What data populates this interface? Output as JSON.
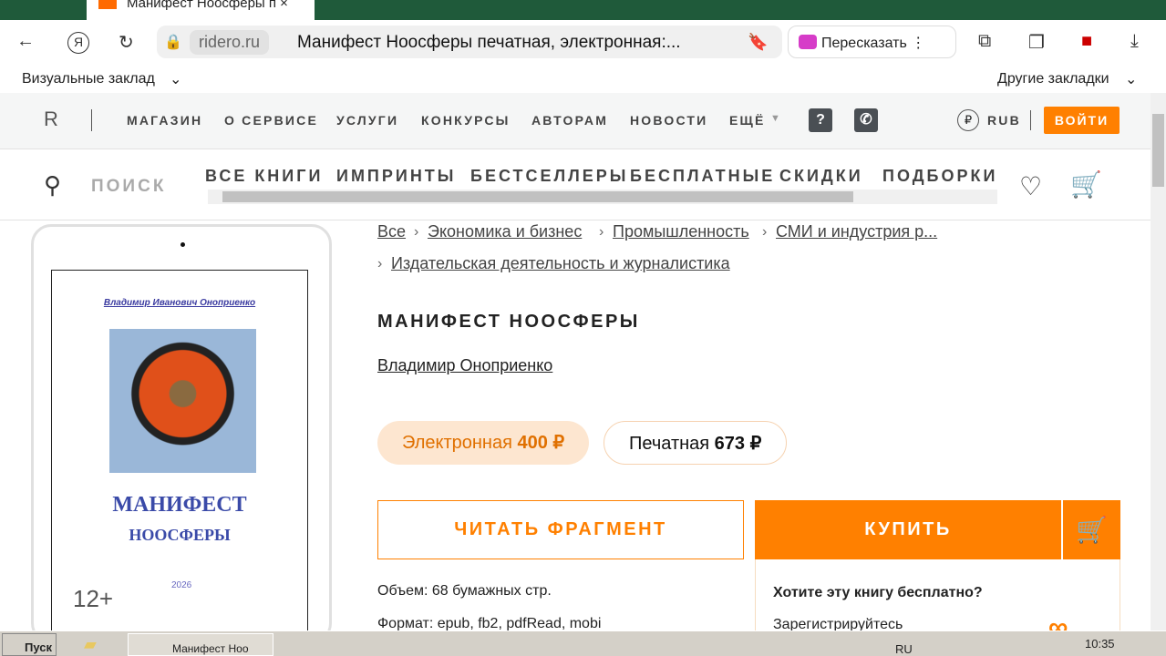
{
  "browser": {
    "tab_title": "Манифест Ноосферы п",
    "domain": "ridero.ru",
    "page_title": "Манифест Ноосферы печатная, электронная:...",
    "retell": "Пересказать",
    "bookmarks_left": "Визуальные заклад",
    "bookmarks_right": "Другие закладки"
  },
  "site": {
    "logo": "R",
    "nav": [
      "МАГАЗИН",
      "О СЕРВИСЕ",
      "УСЛУГИ",
      "КОНКУРСЫ",
      "АВТОРАМ",
      "НОВОСТИ",
      "ЕЩЁ"
    ],
    "help": "?",
    "currency": "RUB",
    "login": "ВОЙТИ",
    "search": "ПОИСК",
    "categories": [
      "ВСЕ КНИГИ",
      "ИМПРИНТЫ",
      "БЕСТСЕЛЛЕРЫ",
      "БЕСПЛАТНЫЕ",
      "СКИДКИ",
      "ПОДБОРКИ"
    ]
  },
  "cover": {
    "author": "Владимир Иванович Оноприенко",
    "title1": "МАНИФЕСТ",
    "title2": "НООСФЕРЫ",
    "year": "2026",
    "age": "12+"
  },
  "book": {
    "breadcrumbs": [
      "Все",
      "Экономика и бизнес",
      "Промышленность",
      "СМИ и индустрия р...",
      "Издательская деятельность и журналистика"
    ],
    "title": "МАНИФЕСТ НООСФЕРЫ",
    "author": "Владимир Оноприенко",
    "ebook_label": "Электронная",
    "ebook_price": "400 ₽",
    "print_label": "Печатная",
    "print_price": "673 ₽",
    "read_button": "ЧИТАТЬ ФРАГМЕНТ",
    "buy_button": "КУПИТЬ",
    "volume": "Объем: 68 бумажных стр.",
    "format": "Формат: epub, fb2, pdfRead, mobi",
    "free_title": "Хотите эту книгу бесплатно?",
    "free_text": "Зарегистрируйтесь"
  },
  "taskbar": {
    "start": "Пуск",
    "window": "Манифест Ноо",
    "lang": "RU",
    "time": "10:35"
  }
}
